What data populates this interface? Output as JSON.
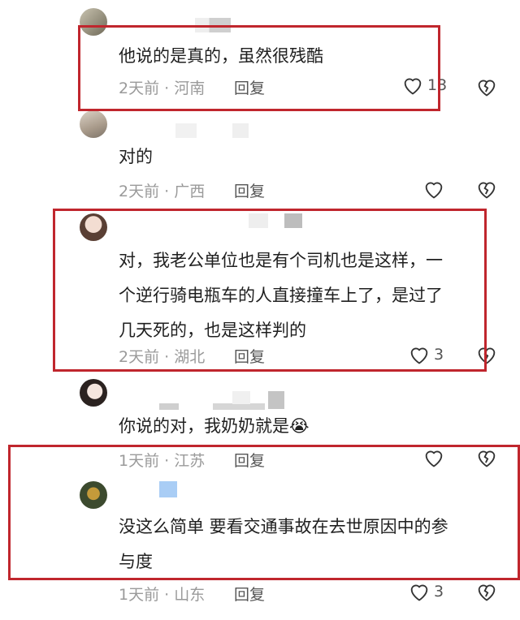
{
  "comments": [
    {
      "text": "他说的是真的，虽然很残酷",
      "meta": "2天前 · 河南",
      "reply": "回复",
      "likes": "13"
    },
    {
      "text": "对的",
      "meta": "2天前 · 广西",
      "reply": "回复",
      "likes": ""
    },
    {
      "text": "对，我老公单位也是有个司机也是这样，一\n个逆行骑电瓶车的人直接撞车上了，是过了\n几天死的，也是这样判的",
      "meta": "2天前 · 湖北",
      "reply": "回复",
      "likes": "3"
    },
    {
      "text": "你说的对，我奶奶就是😭",
      "meta": "1天前 · 江苏",
      "reply": "回复",
      "likes": ""
    },
    {
      "text": "没这么简单 要看交通事故在去世原因中的参\n与度",
      "meta": "1天前 · 山东",
      "reply": "回复",
      "likes": "3"
    }
  ],
  "icons": {
    "like": "heart-outline-icon",
    "dislike": "broken-heart-outline-icon"
  },
  "colors": {
    "highlight_box": "#c0262d",
    "meta_text": "#9a9a9a"
  }
}
